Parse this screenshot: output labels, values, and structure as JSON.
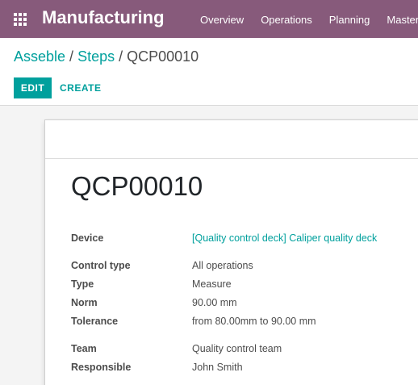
{
  "app": {
    "title": "Manufacturing",
    "menu": [
      "Overview",
      "Operations",
      "Planning",
      "Master"
    ]
  },
  "breadcrumb": {
    "items": [
      "Asseble",
      "Steps"
    ],
    "current": "QCP00010"
  },
  "buttons": {
    "edit": "EDIT",
    "create": "CREATE"
  },
  "record": {
    "title": "QCP00010",
    "fields": {
      "device": {
        "label": "Device",
        "value": "[Quality control deck] Caliper quality deck"
      },
      "control_type": {
        "label": "Control type",
        "value": "All operations"
      },
      "type": {
        "label": "Type",
        "value": "Measure"
      },
      "norm": {
        "label": "Norm",
        "value": "90.00 mm"
      },
      "tolerance": {
        "label": "Tolerance",
        "value": "from 80.00mm to 90.00 mm"
      },
      "team": {
        "label": "Team",
        "value": "Quality control team"
      },
      "responsible": {
        "label": "Responsible",
        "value": "John Smith"
      }
    }
  },
  "colors": {
    "topbar": "#875a7b",
    "accent": "#00a09d"
  }
}
